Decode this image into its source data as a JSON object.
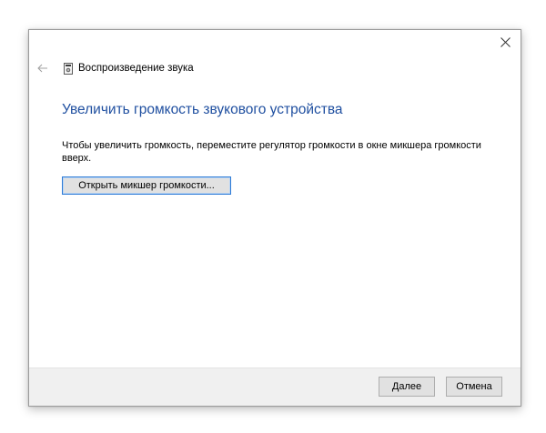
{
  "window": {
    "close_icon": "close-icon"
  },
  "header": {
    "back_icon": "back-arrow-icon",
    "app_icon": "speaker-troubleshooter-icon",
    "title": "Воспроизведение звука"
  },
  "main": {
    "heading": "Увеличить громкость звукового устройства",
    "description": "Чтобы увеличить громкость, переместите регулятор громкости в окне микшера громкости вверх.",
    "mixer_button_label": "Открыть микшер громкости..."
  },
  "footer": {
    "next_accel": "Д",
    "next_rest": "алее",
    "cancel_label": "Отмена"
  },
  "colors": {
    "heading": "#1f4fa0",
    "focus_border": "#2d7ad6",
    "footer_bg": "#f0f0f0"
  }
}
